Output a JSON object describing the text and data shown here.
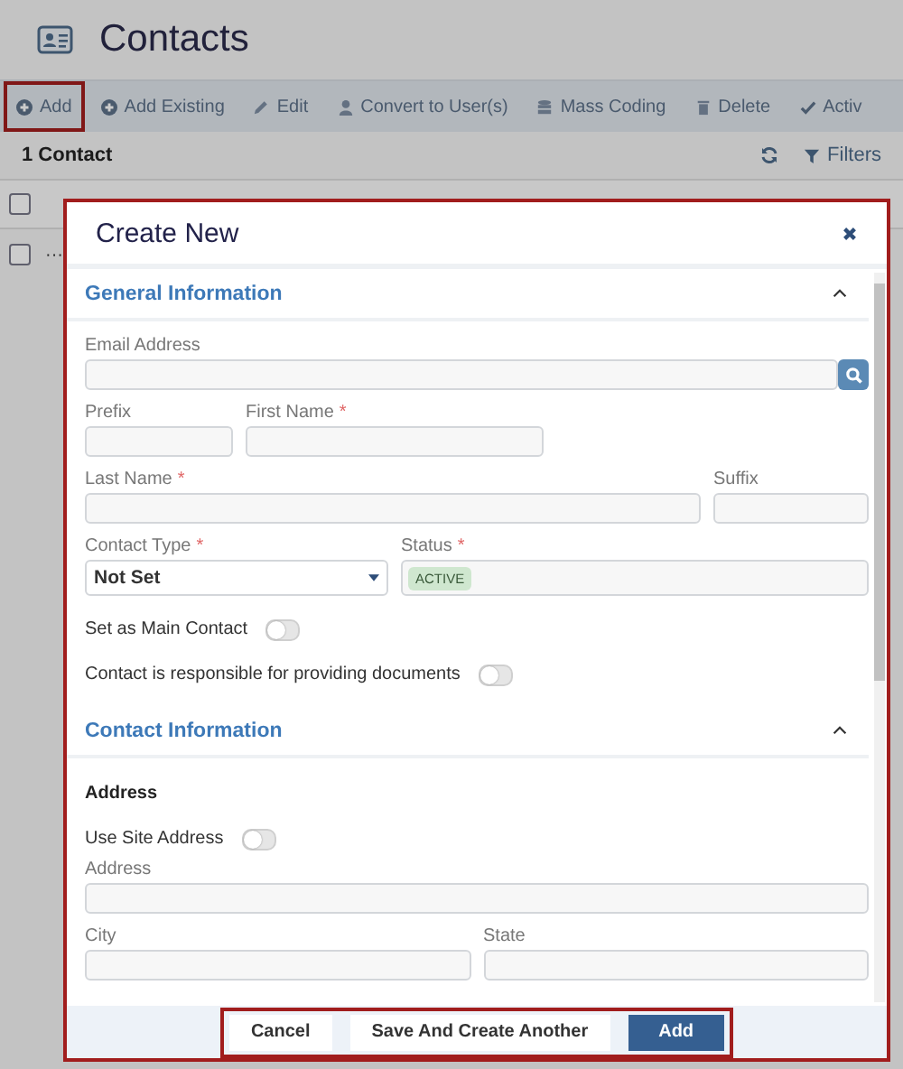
{
  "page": {
    "title": "Contacts"
  },
  "toolbar": [
    {
      "label": "Add",
      "highlighted": true
    },
    {
      "label": "Add Existing",
      "highlighted": false
    },
    {
      "label": "Edit",
      "highlighted": false
    },
    {
      "label": "Convert to User(s)",
      "highlighted": false
    },
    {
      "label": "Mass Coding",
      "highlighted": false
    },
    {
      "label": "Delete",
      "highlighted": false
    },
    {
      "label": "Activ",
      "highlighted": false
    }
  ],
  "list_header": {
    "count": "1 Contact",
    "filters": "Filters"
  },
  "table": {
    "select_all_checked": false,
    "rows": [
      {
        "checked": false,
        "more": "···"
      }
    ]
  },
  "modal": {
    "title": "Create New",
    "sections": [
      {
        "title": "General Information",
        "expanded": true,
        "items": [
          {
            "kind": "fields",
            "fields": [
              {
                "label": "Email Address",
                "required": false,
                "kind": "search"
              }
            ]
          },
          {
            "kind": "fields",
            "fields": [
              {
                "label": "Prefix",
                "required": false,
                "kind": "text"
              },
              {
                "label": "First Name",
                "required": "*",
                "kind": "text"
              }
            ]
          },
          {
            "kind": "fields",
            "fields": [
              {
                "label": "Last Name",
                "required": "*",
                "kind": "text"
              },
              {
                "label": "Suffix",
                "required": false,
                "kind": "text"
              }
            ]
          },
          {
            "kind": "fields",
            "fields": [
              {
                "label": "Contact Type",
                "required": "*",
                "kind": "select",
                "value": "Not Set"
              },
              {
                "label": "Status",
                "required": "*",
                "kind": "tags",
                "tags": [
                  "ACTIVE"
                ]
              }
            ]
          },
          {
            "kind": "toggle",
            "label": "Set as Main Contact",
            "on": false
          },
          {
            "kind": "toggle",
            "label": "Contact is responsible for providing documents",
            "on": false
          }
        ]
      },
      {
        "title": "Contact Information",
        "expanded": true,
        "items": [
          {
            "kind": "subheading",
            "text": "Address"
          },
          {
            "kind": "toggle",
            "label": "Use Site Address",
            "on": false
          },
          {
            "kind": "fields",
            "fields": [
              {
                "label": "Address",
                "required": false,
                "kind": "text"
              }
            ]
          },
          {
            "kind": "fields",
            "fields": [
              {
                "label": "City",
                "required": false,
                "kind": "text"
              },
              {
                "label": "State",
                "required": false,
                "kind": "text"
              }
            ]
          }
        ]
      }
    ],
    "buttons": [
      {
        "label": "Cancel",
        "primary": false
      },
      {
        "label": "Save And Create Another",
        "primary": false
      },
      {
        "label": "Add",
        "primary": true
      }
    ],
    "buttons_highlighted": true
  }
}
